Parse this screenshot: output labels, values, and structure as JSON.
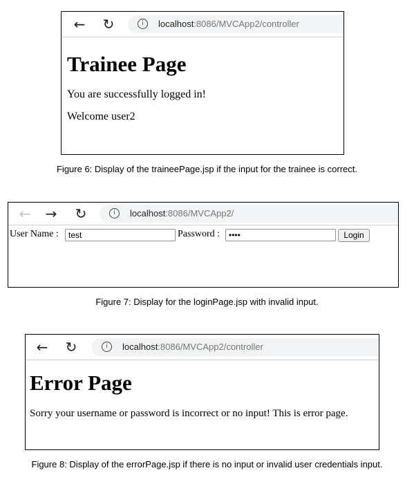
{
  "figure6": {
    "browser": {
      "url_host": "localhost",
      "url_rest": ":8086/MVCApp2/controller"
    },
    "page": {
      "heading": "Trainee Page",
      "line1": "You are successfully logged in!",
      "line2": "Welcome user2"
    },
    "caption": "Figure 6: Display of the traineePage.jsp if the input for the trainee is correct."
  },
  "figure7": {
    "browser": {
      "url_host": "localhost",
      "url_rest": ":8086/MVCApp2/"
    },
    "form": {
      "username_label": "User Name :",
      "username_value": "test",
      "password_label": "Password :",
      "password_value": "••••",
      "login_label": "Login"
    },
    "caption": "Figure 7: Display for the loginPage.jsp with invalid input."
  },
  "figure8": {
    "browser": {
      "url_host": "localhost",
      "url_rest": ":8086/MVCApp2/controller"
    },
    "page": {
      "heading": "Error Page",
      "line1": "Sorry your username or password is incorrect or no input! This is error page."
    },
    "caption": "Figure 8: Display of the errorPage.jsp if there is no input or invalid user credentials input."
  },
  "icons": {
    "back": "←",
    "forward": "→",
    "reload": "↻",
    "info": "i"
  }
}
